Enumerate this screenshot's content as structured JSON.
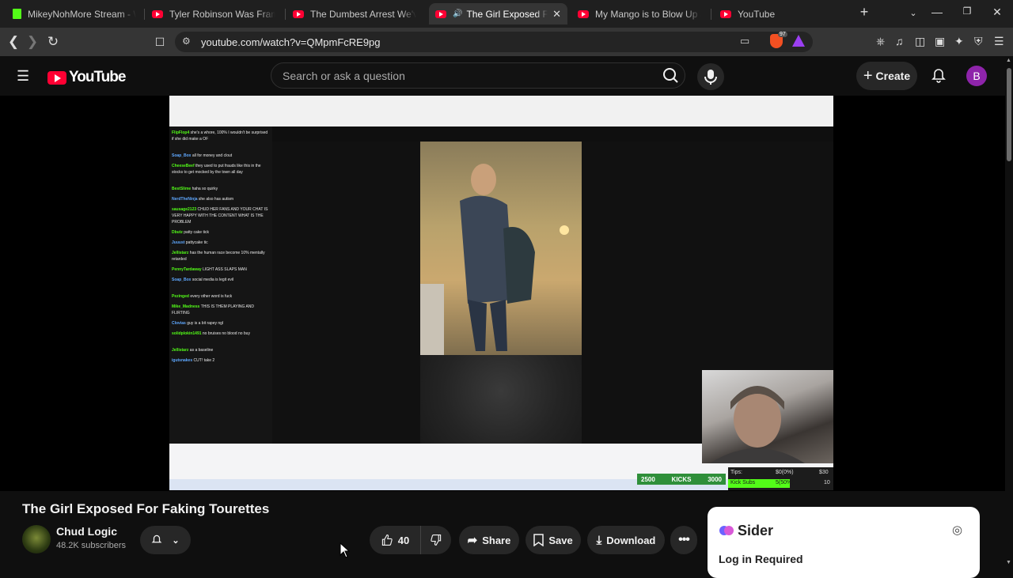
{
  "browser": {
    "tabs": [
      {
        "title": "MikeyNohMore Stream - Watch",
        "icon": "kick-favicon"
      },
      {
        "title": "Tyler Robinson Was Framed, He",
        "icon": "youtube-favicon"
      },
      {
        "title": "The Dumbest Arrest We've Ever",
        "icon": "youtube-favicon"
      },
      {
        "title": "The Girl Exposed For Faking",
        "icon": "youtube-favicon",
        "active": true
      },
      {
        "title": "My Mango is to Blow Up and Th",
        "icon": "youtube-favicon"
      },
      {
        "title": "YouTube",
        "icon": "youtube-favicon"
      }
    ],
    "url": "youtube.com/watch?v=QMpmFcRE9pg",
    "brave_badge": "97"
  },
  "youtube": {
    "logo_text": "YouTube",
    "search_placeholder": "Search or ask a question",
    "create_label": "Create",
    "avatar_letter": "B"
  },
  "video": {
    "title": "The Girl Exposed For Faking Tourettes",
    "channel": "Chud Logic",
    "subscribers": "48.2K subscribers",
    "likes": "40",
    "share_label": "Share",
    "save_label": "Save",
    "download_label": "Download"
  },
  "overlay": {
    "chat": [
      {
        "user": "FlipFlop4",
        "msg": "she's a whore, 100% I wouldn't be surprised if she did make a OF"
      },
      {
        "user": "Soap_Box",
        "msg": "all for money and clout"
      },
      {
        "user": "CheeseBeef",
        "msg": "they used to put frauds like this in the stocks to get mocked by the town all day"
      },
      {
        "user": "BestSlime",
        "msg": "haha so quirky"
      },
      {
        "user": "NerdTheNinja",
        "msg": "she also has autism"
      },
      {
        "user": "sausage2123",
        "msg": "CHUD HER FANS AND YOUR CHAT IS VERY HAPPY WITH THE CONTENT WHAT IS THE PROBLEM"
      },
      {
        "user": "Dbutz",
        "msg": "patty cake tick"
      },
      {
        "user": "Juuust",
        "msg": "pattycake tic"
      },
      {
        "user": "Jellistarz",
        "msg": "has the human race become 10% mentally retarded"
      },
      {
        "user": "PennyTardaway",
        "msg": "LIGHT ASS SLAPS MAN"
      },
      {
        "user": "Soap_Box",
        "msg": "social media is legit evil"
      },
      {
        "user": "Pezinged",
        "msg": "every other word is fuck"
      },
      {
        "user": "Mike_Madness",
        "msg": "THIS IS THEM PLAYING AND FLIRTING"
      },
      {
        "user": "Clovias",
        "msg": "guy is a bit rapey ngl"
      },
      {
        "user": "solidplokin1491",
        "msg": "no bruises no blood no buy"
      },
      {
        "user": "Jellistarz",
        "msg": "as a baseline"
      },
      {
        "user": "igutsnakes",
        "msg": "CUT! take 2"
      }
    ],
    "kick_goal": {
      "current": "2500",
      "label": "KICKS",
      "target": "3000"
    },
    "tips_label": "Tips:",
    "tips_value": "$0(0%)",
    "tips_target": "$30",
    "kick_subs": "Kick Subs",
    "kick_subs_value": "5(50%)",
    "kick_subs_target": "10"
  },
  "sider": {
    "title": "Sider",
    "login": "Log in Required"
  },
  "colors": {
    "youtube_red": "#ff0033",
    "kick_green": "#53fc18",
    "background": "#0f0f0f"
  }
}
